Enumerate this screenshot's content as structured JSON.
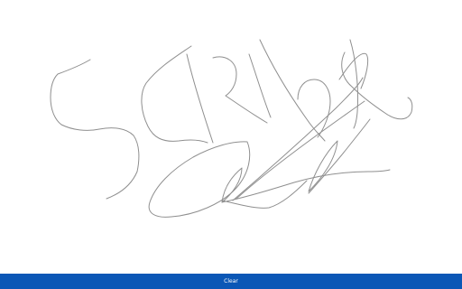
{
  "canvas": {
    "background": "#ffffff",
    "stroke_color": "#8f8f8f"
  },
  "bottom_bar": {
    "color": "#0b57b6",
    "clear_label": "Clear"
  }
}
